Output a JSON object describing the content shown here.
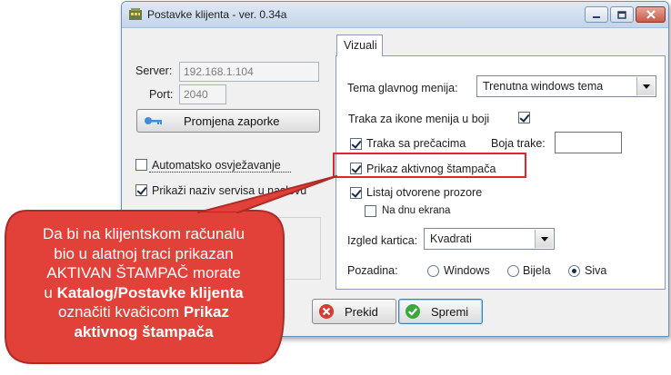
{
  "window": {
    "title": "Postavke klijenta - ver. 0.34a"
  },
  "left": {
    "server_label": "Server:",
    "server_value": "192.168.1.104",
    "port_label": "Port:",
    "port_value": "2040",
    "change_password_button": "Promjena zaporke",
    "auto_refresh_label": "Automatsko osvježavanje",
    "auto_refresh_checked": false,
    "show_service_name_label": "Prikaži naziv servisa u naslovu",
    "show_service_name_checked": true
  },
  "tabs": [
    {
      "label": "Vizuali"
    }
  ],
  "visuals": {
    "menu_theme_label": "Tema glavnog menija:",
    "menu_theme_value": "Trenutna windows tema",
    "icon_bar_color_label": "Traka za ikone menija u boji",
    "icon_bar_color_checked": true,
    "shortcut_bar_label": "Traka sa prečacima",
    "shortcut_bar_checked": true,
    "bar_color_label": "Boja trake:",
    "active_printer_label": "Prikaz aktivnog štampača",
    "active_printer_checked": true,
    "list_open_windows_label": "Listaj otvorene prozore",
    "list_open_windows_checked": true,
    "bottom_screen_label": "Na dnu ekrana",
    "bottom_screen_checked": false,
    "tabs_look_label": "Izgled kartica:",
    "tabs_look_value": "Kvadrati",
    "background_label": "Pozadina:",
    "background_options": [
      "Windows",
      "Bijela",
      "Siva"
    ],
    "background_selected": "Siva"
  },
  "buttons": {
    "cancel": "Prekid",
    "save": "Spremi"
  },
  "callout": {
    "line1": "Da bi na klijentskom računalu",
    "line2": "bio u alatnoj traci prikazan",
    "line3": "AKTIVAN ŠTAMPAČ morate",
    "line4_pre": "u ",
    "line4_bold": "Katalog/Postavke klijenta",
    "line5_pre": "označiti kvačicom ",
    "line5_bold": "Prikaz",
    "line6_bold": "aktivnog štampača",
    "fill_color": "#e2413a",
    "border_color": "#b02a26"
  },
  "colors": {
    "highlight": "#e0242a"
  }
}
